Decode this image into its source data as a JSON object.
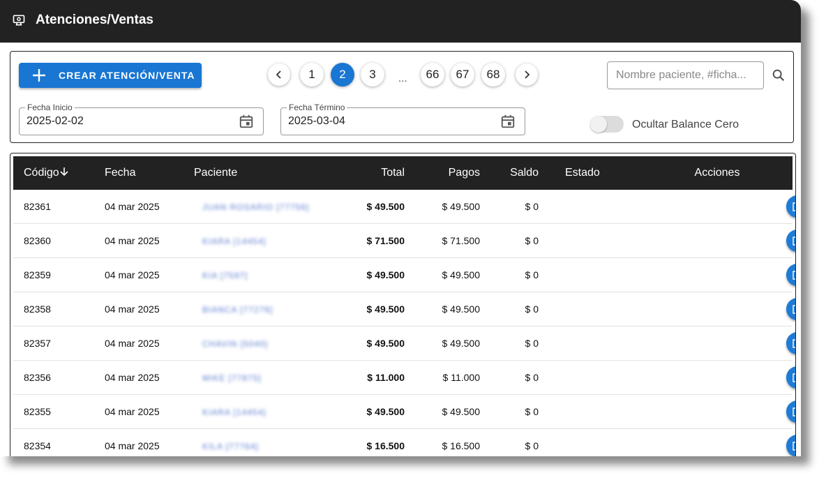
{
  "header": {
    "title": "Atenciones/Ventas",
    "icon": "money-monitor-icon"
  },
  "toolbar": {
    "create_label": "CREAR ATENCIÓN/VENTA"
  },
  "pagination": {
    "pages": [
      "1",
      "2",
      "3",
      "66",
      "67",
      "68"
    ],
    "current": "2",
    "ellipsis": "..."
  },
  "search": {
    "placeholder": "Nombre paciente, #ficha...",
    "value": ""
  },
  "filters": {
    "start_label": "Fecha Inicio",
    "start_value": "2025-02-02",
    "end_label": "Fecha Término",
    "end_value": "2025-03-04",
    "toggle_label": "Ocultar Balance Cero",
    "toggle_on": false
  },
  "table": {
    "columns": [
      "Código",
      "Fecha",
      "Paciente",
      "Total",
      "Pagos",
      "Saldo",
      "Estado",
      "Acciones"
    ],
    "sort_column": "Código",
    "rows": [
      {
        "code": "82361",
        "date": "04 mar 2025",
        "patient": "JUAN ROSARIO [77756]",
        "total": "$ 49.500",
        "pagos": "$ 49.500",
        "saldo": "$ 0",
        "estado": ""
      },
      {
        "code": "82360",
        "date": "04 mar 2025",
        "patient": "KIARA [14454]",
        "total": "$ 71.500",
        "pagos": "$ 71.500",
        "saldo": "$ 0",
        "estado": ""
      },
      {
        "code": "82359",
        "date": "04 mar 2025",
        "patient": "KIA [7597]",
        "total": "$ 49.500",
        "pagos": "$ 49.500",
        "saldo": "$ 0",
        "estado": ""
      },
      {
        "code": "82358",
        "date": "04 mar 2025",
        "patient": "BIANCA [77276]",
        "total": "$ 49.500",
        "pagos": "$ 49.500",
        "saldo": "$ 0",
        "estado": ""
      },
      {
        "code": "82357",
        "date": "04 mar 2025",
        "patient": "CHAVIN [5040]",
        "total": "$ 49.500",
        "pagos": "$ 49.500",
        "saldo": "$ 0",
        "estado": ""
      },
      {
        "code": "82356",
        "date": "04 mar 2025",
        "patient": "MIKE [77875]",
        "total": "$ 11.000",
        "pagos": "$ 11.000",
        "saldo": "$ 0",
        "estado": ""
      },
      {
        "code": "82355",
        "date": "04 mar 2025",
        "patient": "KIARA [14454]",
        "total": "$ 49.500",
        "pagos": "$ 49.500",
        "saldo": "$ 0",
        "estado": ""
      },
      {
        "code": "82354",
        "date": "04 mar 2025",
        "patient": "KILA [77764]",
        "total": "$ 16.500",
        "pagos": "$ 16.500",
        "saldo": "$ 0",
        "estado": ""
      }
    ]
  },
  "colors": {
    "primary": "#1976d2",
    "header": "#222222",
    "edit": "#1e7bd6",
    "pay": "#f28a00",
    "mail": "#3fae45",
    "pdf": "#f04848"
  },
  "action_icons": [
    "edit-icon",
    "credit-card-icon",
    "mail-icon",
    "pdf-icon"
  ]
}
